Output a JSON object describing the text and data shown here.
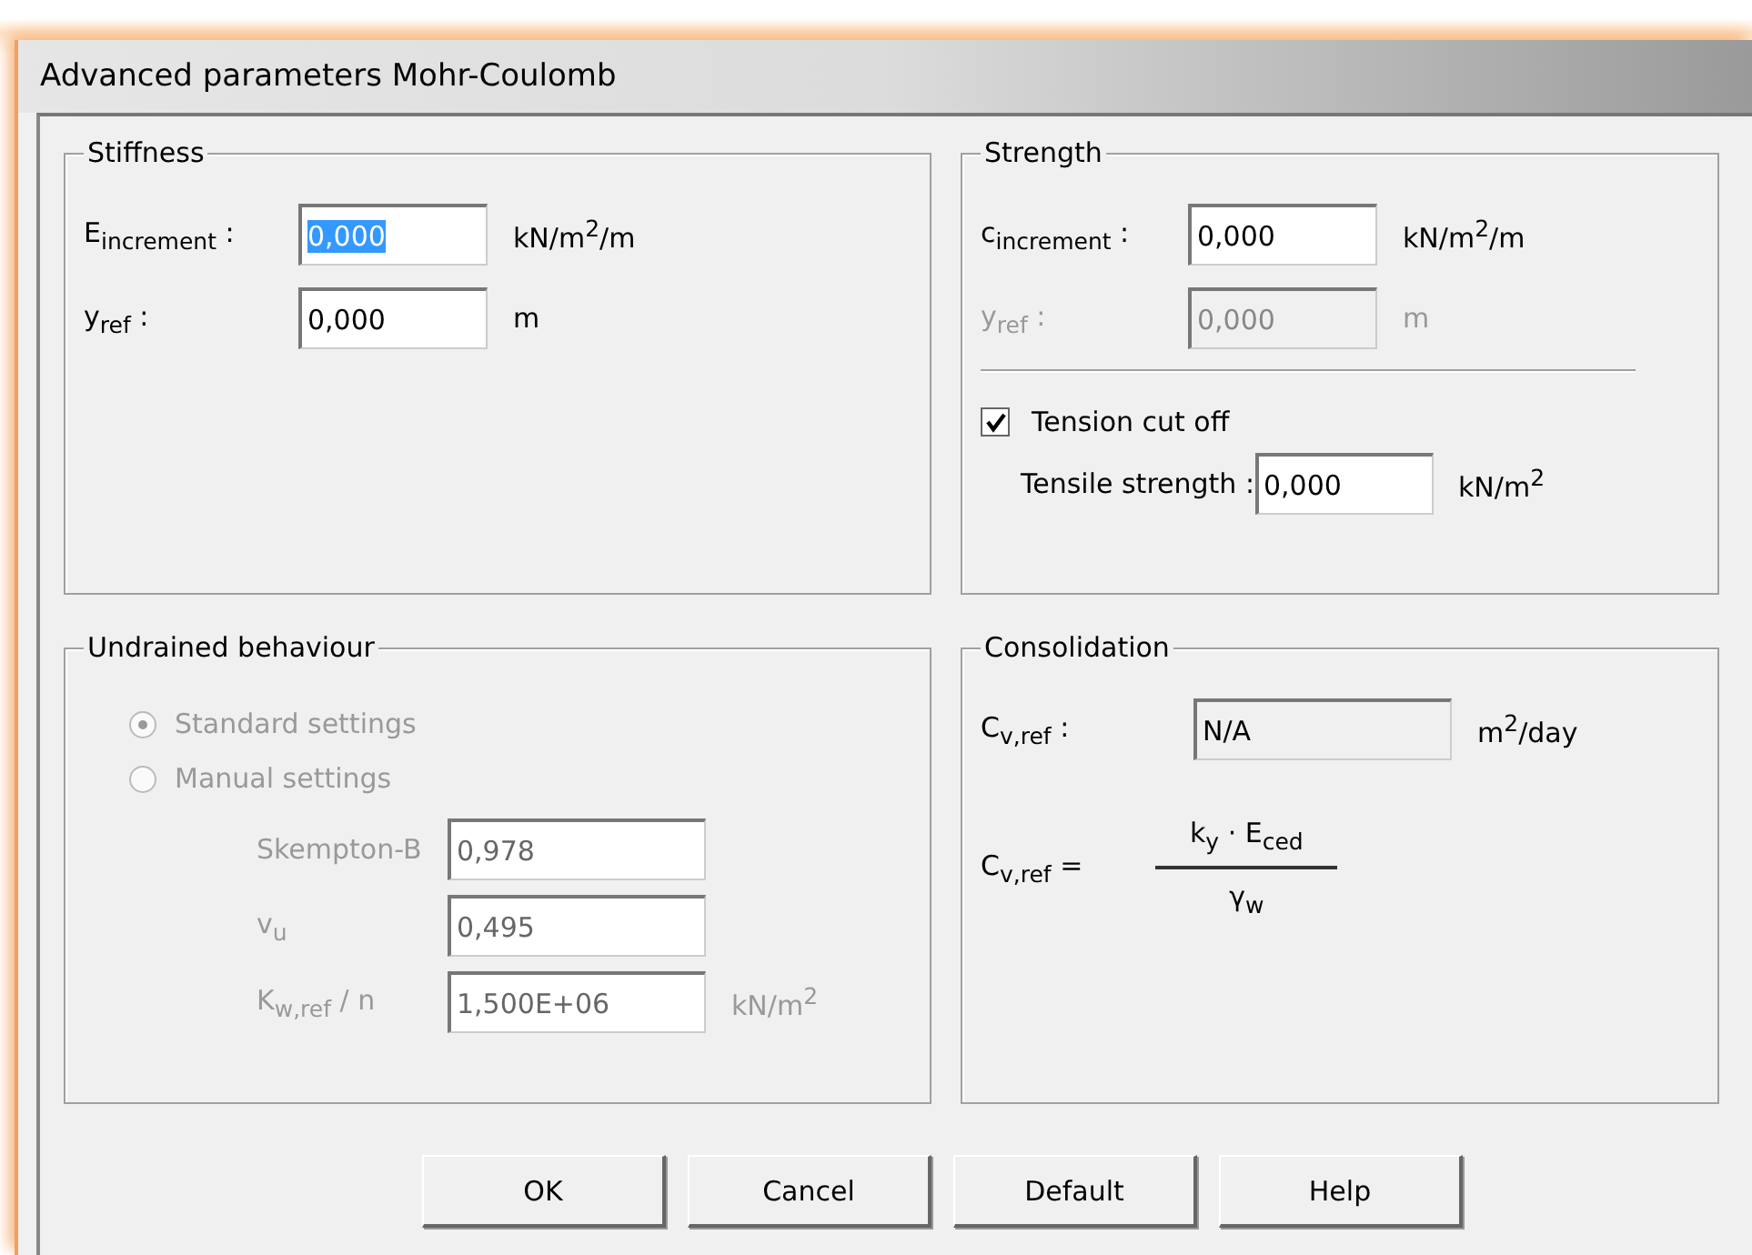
{
  "window": {
    "title": "Advanced parameters Mohr-Coulomb"
  },
  "stiffness": {
    "title": "Stiffness",
    "fields": [
      {
        "label": "E$_{increment}$ :",
        "value": "0,000",
        "unit": "kN/m$^{2}$/m",
        "disabled": false,
        "text_selected": true
      },
      {
        "label": "y$_{ref}$ :",
        "value": "0,000",
        "unit": "m",
        "disabled": false,
        "text_selected": false
      }
    ]
  },
  "strength": {
    "title": "Strength",
    "fields": [
      {
        "label": "c$_{increment}$ :",
        "value": "0,000",
        "unit": "kN/m$^{2}$/m",
        "disabled": false,
        "text_selected": false
      },
      {
        "label": "y$_{ref}$ :",
        "value": "0,000",
        "unit": "m",
        "disabled": true,
        "text_selected": false
      }
    ],
    "checkbox": {
      "label": "Tension cut off",
      "checked": true
    },
    "tensile": {
      "label": "Tensile strength :",
      "value": "0,000",
      "unit": "kN/m$^{2}$"
    }
  },
  "undrained": {
    "title": "Undrained behaviour",
    "disabled": true,
    "radios": [
      {
        "label": "Standard settings",
        "selected": true
      },
      {
        "label": "Manual settings",
        "selected": false
      }
    ],
    "fields": [
      {
        "label": "Skempton-B",
        "value": "0,978"
      },
      {
        "label": "v$_{u}$",
        "value": "0,495"
      },
      {
        "label": "K$_{w,ref}$ / n",
        "value": "1,500E+06",
        "unit": "kN/m$^{2}$"
      }
    ]
  },
  "consolidation": {
    "title": "Consolidation",
    "field": {
      "label": "C$_{v,ref}$ :",
      "value": "N/A",
      "unit": "m$^{2}$/day"
    },
    "formula": {
      "lhs": "C$_{v,ref}$ =",
      "numerator": "k$_{y}$ · E$_{ced}$",
      "denominator": "γ$_{w}$"
    }
  },
  "buttons": [
    "OK",
    "Cancel",
    "Default",
    "Help"
  ]
}
